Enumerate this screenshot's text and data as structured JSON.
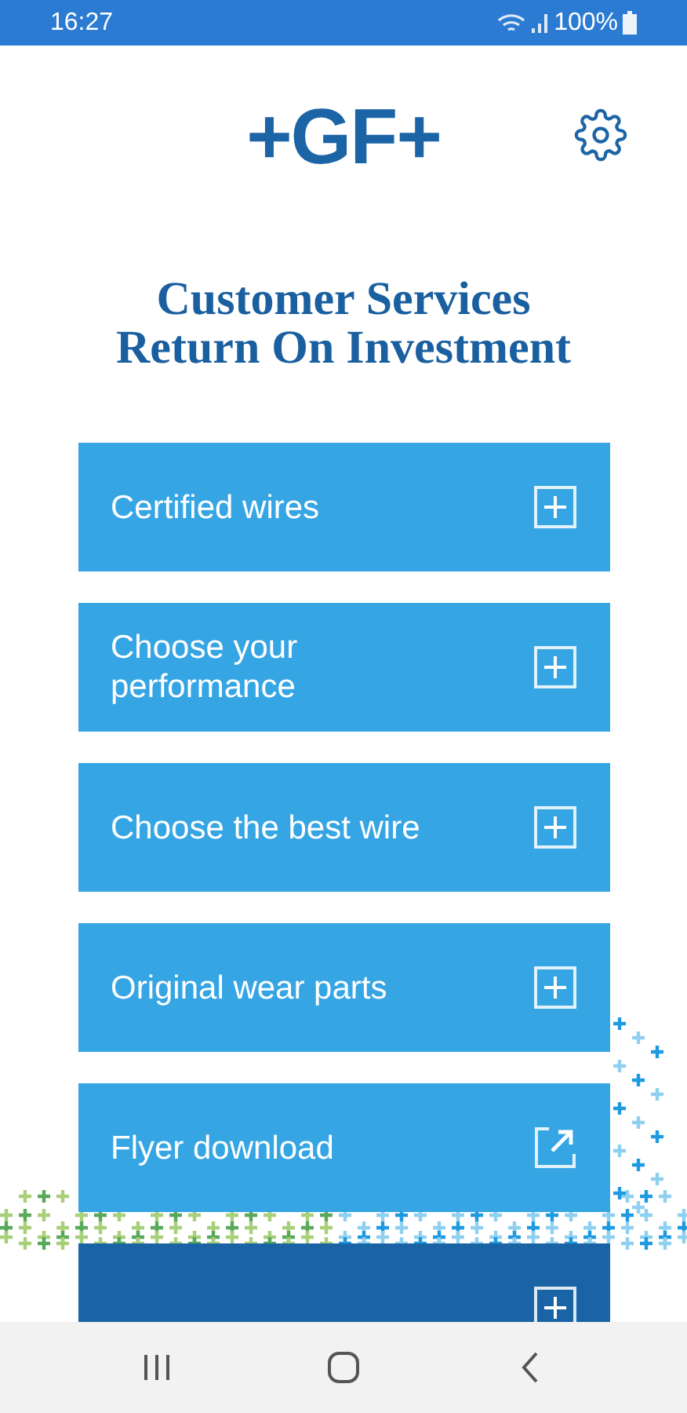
{
  "status_bar": {
    "time": "16:27",
    "battery": "100%"
  },
  "header": {
    "logo": "+GF+"
  },
  "title": [
    "Customer Services",
    "Return On Investment"
  ],
  "menu": [
    {
      "label": "Certified wires",
      "kind": "expand",
      "color": "#35a5e4"
    },
    {
      "label": "Choose your performance",
      "kind": "expand",
      "color": "#35a5e4"
    },
    {
      "label": "Choose the best wire",
      "kind": "expand",
      "color": "#35a5e4"
    },
    {
      "label": "Original wear parts",
      "kind": "expand",
      "color": "#35a5e4"
    },
    {
      "label": "Flyer download",
      "kind": "external",
      "color": "#35a5e4"
    },
    {
      "kind": "expand",
      "color": "#1a63a5"
    }
  ]
}
